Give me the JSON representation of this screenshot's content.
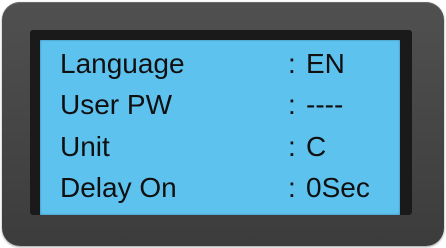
{
  "display": {
    "rows": [
      {
        "label": "Language",
        "separator": ":",
        "value": "EN"
      },
      {
        "label": "User PW",
        "separator": ":",
        "value": "----"
      },
      {
        "label": "Unit",
        "separator": ":",
        "value": "C"
      },
      {
        "label": "Delay On",
        "separator": ":",
        "value": "0Sec"
      }
    ]
  },
  "colors": {
    "housing": "#444444",
    "bezel": "#1a1a1a",
    "screen": "#5ec2ef",
    "text": "#101010"
  }
}
